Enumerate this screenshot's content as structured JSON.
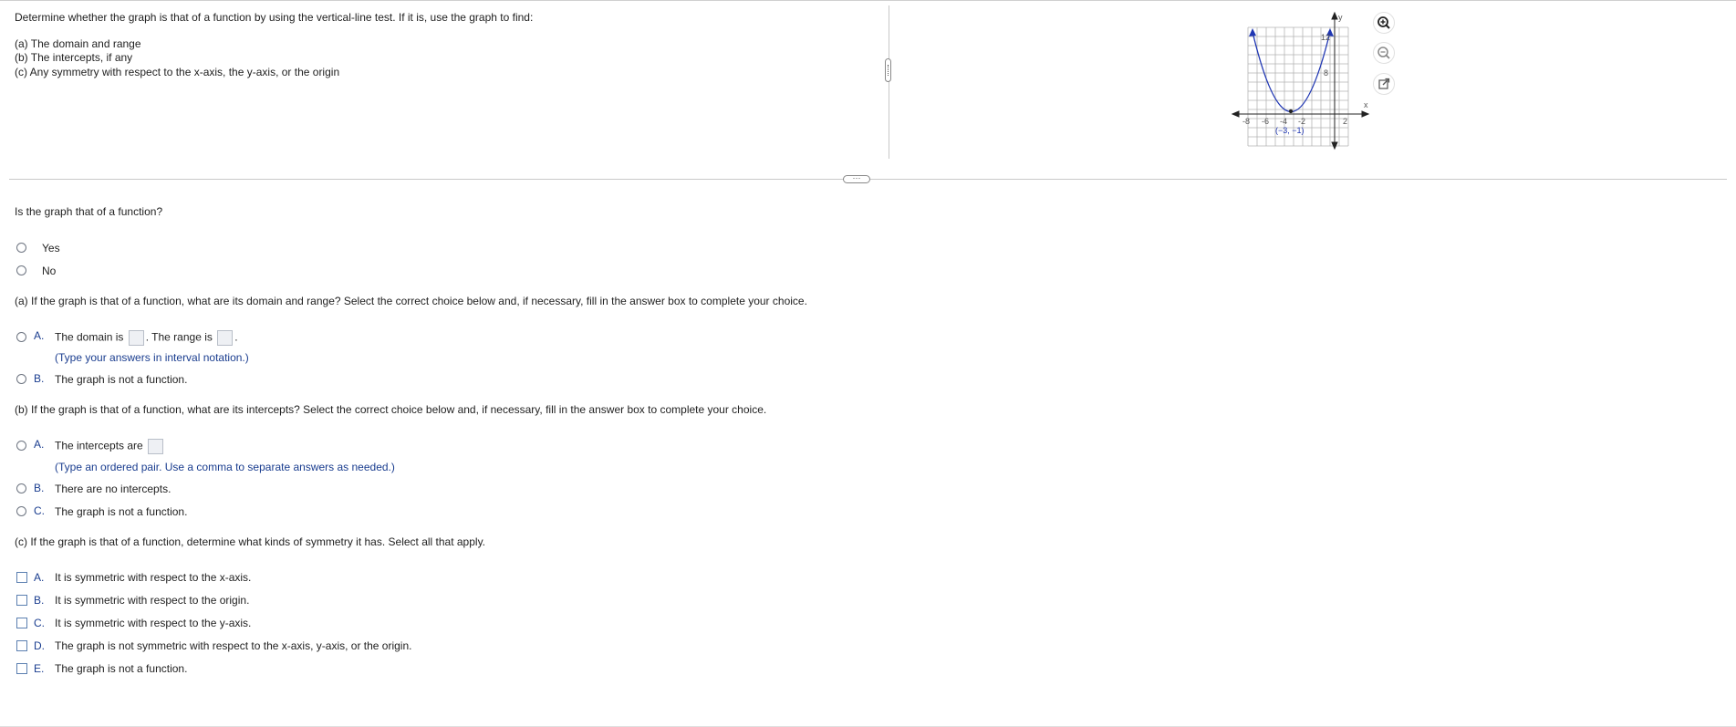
{
  "prompt": {
    "intro": "Determine whether the graph is that of a function by using the vertical-line test. If it is, use the graph to find:",
    "items": [
      "(a) The domain and range",
      "(b) The intercepts, if any",
      "(c) Any symmetry with respect to the x-axis, the y-axis, or the origin"
    ]
  },
  "graph": {
    "x_axis_label": "x",
    "y_axis_label": "y",
    "x_tick_labels": [
      "-8",
      "-6",
      "-4",
      "-2",
      "2"
    ],
    "y_tick_labels": [
      "12",
      "8"
    ],
    "vertex_label": "(−3, −1)",
    "curve_color": "#1f36b3"
  },
  "question1": {
    "text": "Is the graph that of a function?",
    "options": [
      "Yes",
      "No"
    ]
  },
  "partA": {
    "text": "(a) If the graph is that of a function, what are its domain and range? Select the correct choice below and, if necessary, fill in the answer box to complete your choice.",
    "optA_letter": "A.",
    "optA_text1": "The domain is",
    "optA_text2": ". The range is",
    "optA_text3": ".",
    "optA_hint": "(Type your answers in interval notation.)",
    "optB_letter": "B.",
    "optB_text": "The graph is not a function."
  },
  "partB": {
    "text": "(b) If the graph is that of a function, what are its intercepts? Select the correct choice below and, if necessary, fill in the answer box to complete your choice.",
    "optA_letter": "A.",
    "optA_text": "The intercepts are",
    "optA_hint": "(Type an ordered pair. Use a comma to separate answers as needed.)",
    "optB_letter": "B.",
    "optB_text": "There are no intercepts.",
    "optC_letter": "C.",
    "optC_text": "The graph is not a function."
  },
  "partC": {
    "text": "(c) If the graph is that of a function, determine what kinds of symmetry it has. Select all that apply.",
    "options": [
      {
        "letter": "A.",
        "text": "It is symmetric with respect to the x-axis."
      },
      {
        "letter": "B.",
        "text": "It is symmetric with respect to the origin."
      },
      {
        "letter": "C.",
        "text": "It is symmetric with respect to the y-axis."
      },
      {
        "letter": "D.",
        "text": "The graph is not symmetric with respect to the x-axis, y-axis, or the origin."
      },
      {
        "letter": "E.",
        "text": "The graph is not a function."
      }
    ]
  },
  "tools": [
    "zoom-in-icon",
    "zoom-out-icon",
    "popout-icon"
  ],
  "split_handle": "···"
}
